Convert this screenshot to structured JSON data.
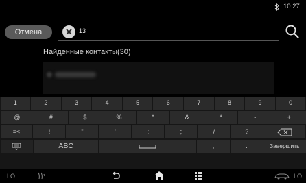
{
  "status": {
    "time": "10:27",
    "bluetooth_icon": "bluetooth-icon"
  },
  "search": {
    "cancel_label": "Отмена",
    "query": "13",
    "clear_icon": "clear-icon",
    "search_icon": "search-icon"
  },
  "results": {
    "header": "Найденные контакты(30)"
  },
  "keyboard": {
    "row1": [
      "1",
      "2",
      "3",
      "4",
      "5",
      "6",
      "7",
      "8",
      "9",
      "0"
    ],
    "row2": [
      "@",
      "#",
      "$",
      "%",
      "^",
      "&",
      "*",
      "-",
      "+"
    ],
    "row3": [
      "=<",
      "!",
      "\"",
      "'",
      ":",
      ";",
      "/",
      "?"
    ],
    "row4": {
      "abc": "ABC",
      "space": "␣",
      "dot": ".",
      "comma": ",",
      "done": "Завершить"
    }
  },
  "nav": {
    "left_label": "LO",
    "right_label": "LO"
  },
  "colors": {
    "background": "#000000",
    "key": "#2b2b2b",
    "text": "#cfcfcf"
  }
}
